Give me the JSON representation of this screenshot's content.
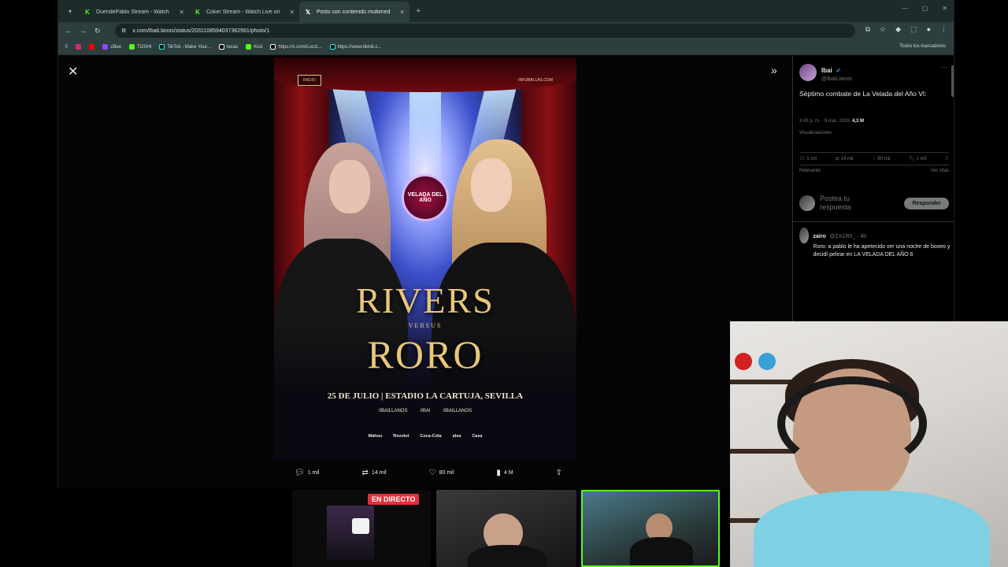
{
  "browser": {
    "tabs": [
      {
        "favicon": "kick",
        "title": "DuendePablo Stream - Watch"
      },
      {
        "favicon": "kick",
        "title": "Coker Stream - Watch Live on"
      },
      {
        "favicon": "x",
        "title": "Posts con contenido multimed"
      }
    ],
    "active_tab": 2,
    "url": "x.com/IbaiLlanos/status/2031108594037362991/photo/1",
    "bookmarks": [
      "cBee",
      "TOSHI",
      "TikTok - Make Your...",
      "Iecas",
      "Kick",
      "https://x.com/Lucst...",
      "https://www.tiktok.c..."
    ],
    "all_bookmarks_label": "Todos los marcadores"
  },
  "poster": {
    "top_left_logo": "RADIO",
    "top_right_text": "INFOBAI.LAS.COM",
    "emblem": "VELADA DEL AÑO",
    "fighter1": "RIVERS",
    "versus": "VERSUS",
    "fighter2": "RORO",
    "event_line": "25 DE JULIO | ESTADIO LA CARTUJA, SEVILLA",
    "socials": [
      "/IBAILLANOS",
      "/IBAI",
      "/IBAILLANOS"
    ],
    "sponsors": [
      "Mahou",
      "Revolut",
      "Coca-Cola",
      "alsa",
      "Casa"
    ]
  },
  "actions": {
    "replies": "1 mil",
    "reposts": "14 mil",
    "likes": "80 mil",
    "views": "4 M"
  },
  "tweet": {
    "name": "Ibai",
    "handle": "@IbaiLlanos",
    "text": "Séptimo combate de La Velada del Año VI:",
    "timestamp": "3:43 p. m. · 9 mar. 2026",
    "views_count": "4,3 M",
    "views_label": "Visualizaciones",
    "stats": {
      "replies": "1 mil",
      "reposts": "14 mil",
      "likes": "80 mil",
      "bookmarks": "1 mil"
    },
    "sort_label": "Relevante",
    "see_quotes": "Ver citas",
    "reply_placeholder": "Postea tu respuesta",
    "reply_button": "Responder",
    "reply": {
      "name": "zairo",
      "handle": "@ZA1R0_ · 4h",
      "text": "Roro: a pablo le ha apetecido ver una noche de boxeo y decidí pelear en LA VELADA DEL AÑO 6"
    }
  },
  "thumbnails": {
    "live_badge": "EN DIRECTO"
  },
  "colors": {
    "kick_green": "#53fc18",
    "live_red": "#e0323c",
    "gold": "#e9c779",
    "x_blue": "#1d9bf0"
  }
}
